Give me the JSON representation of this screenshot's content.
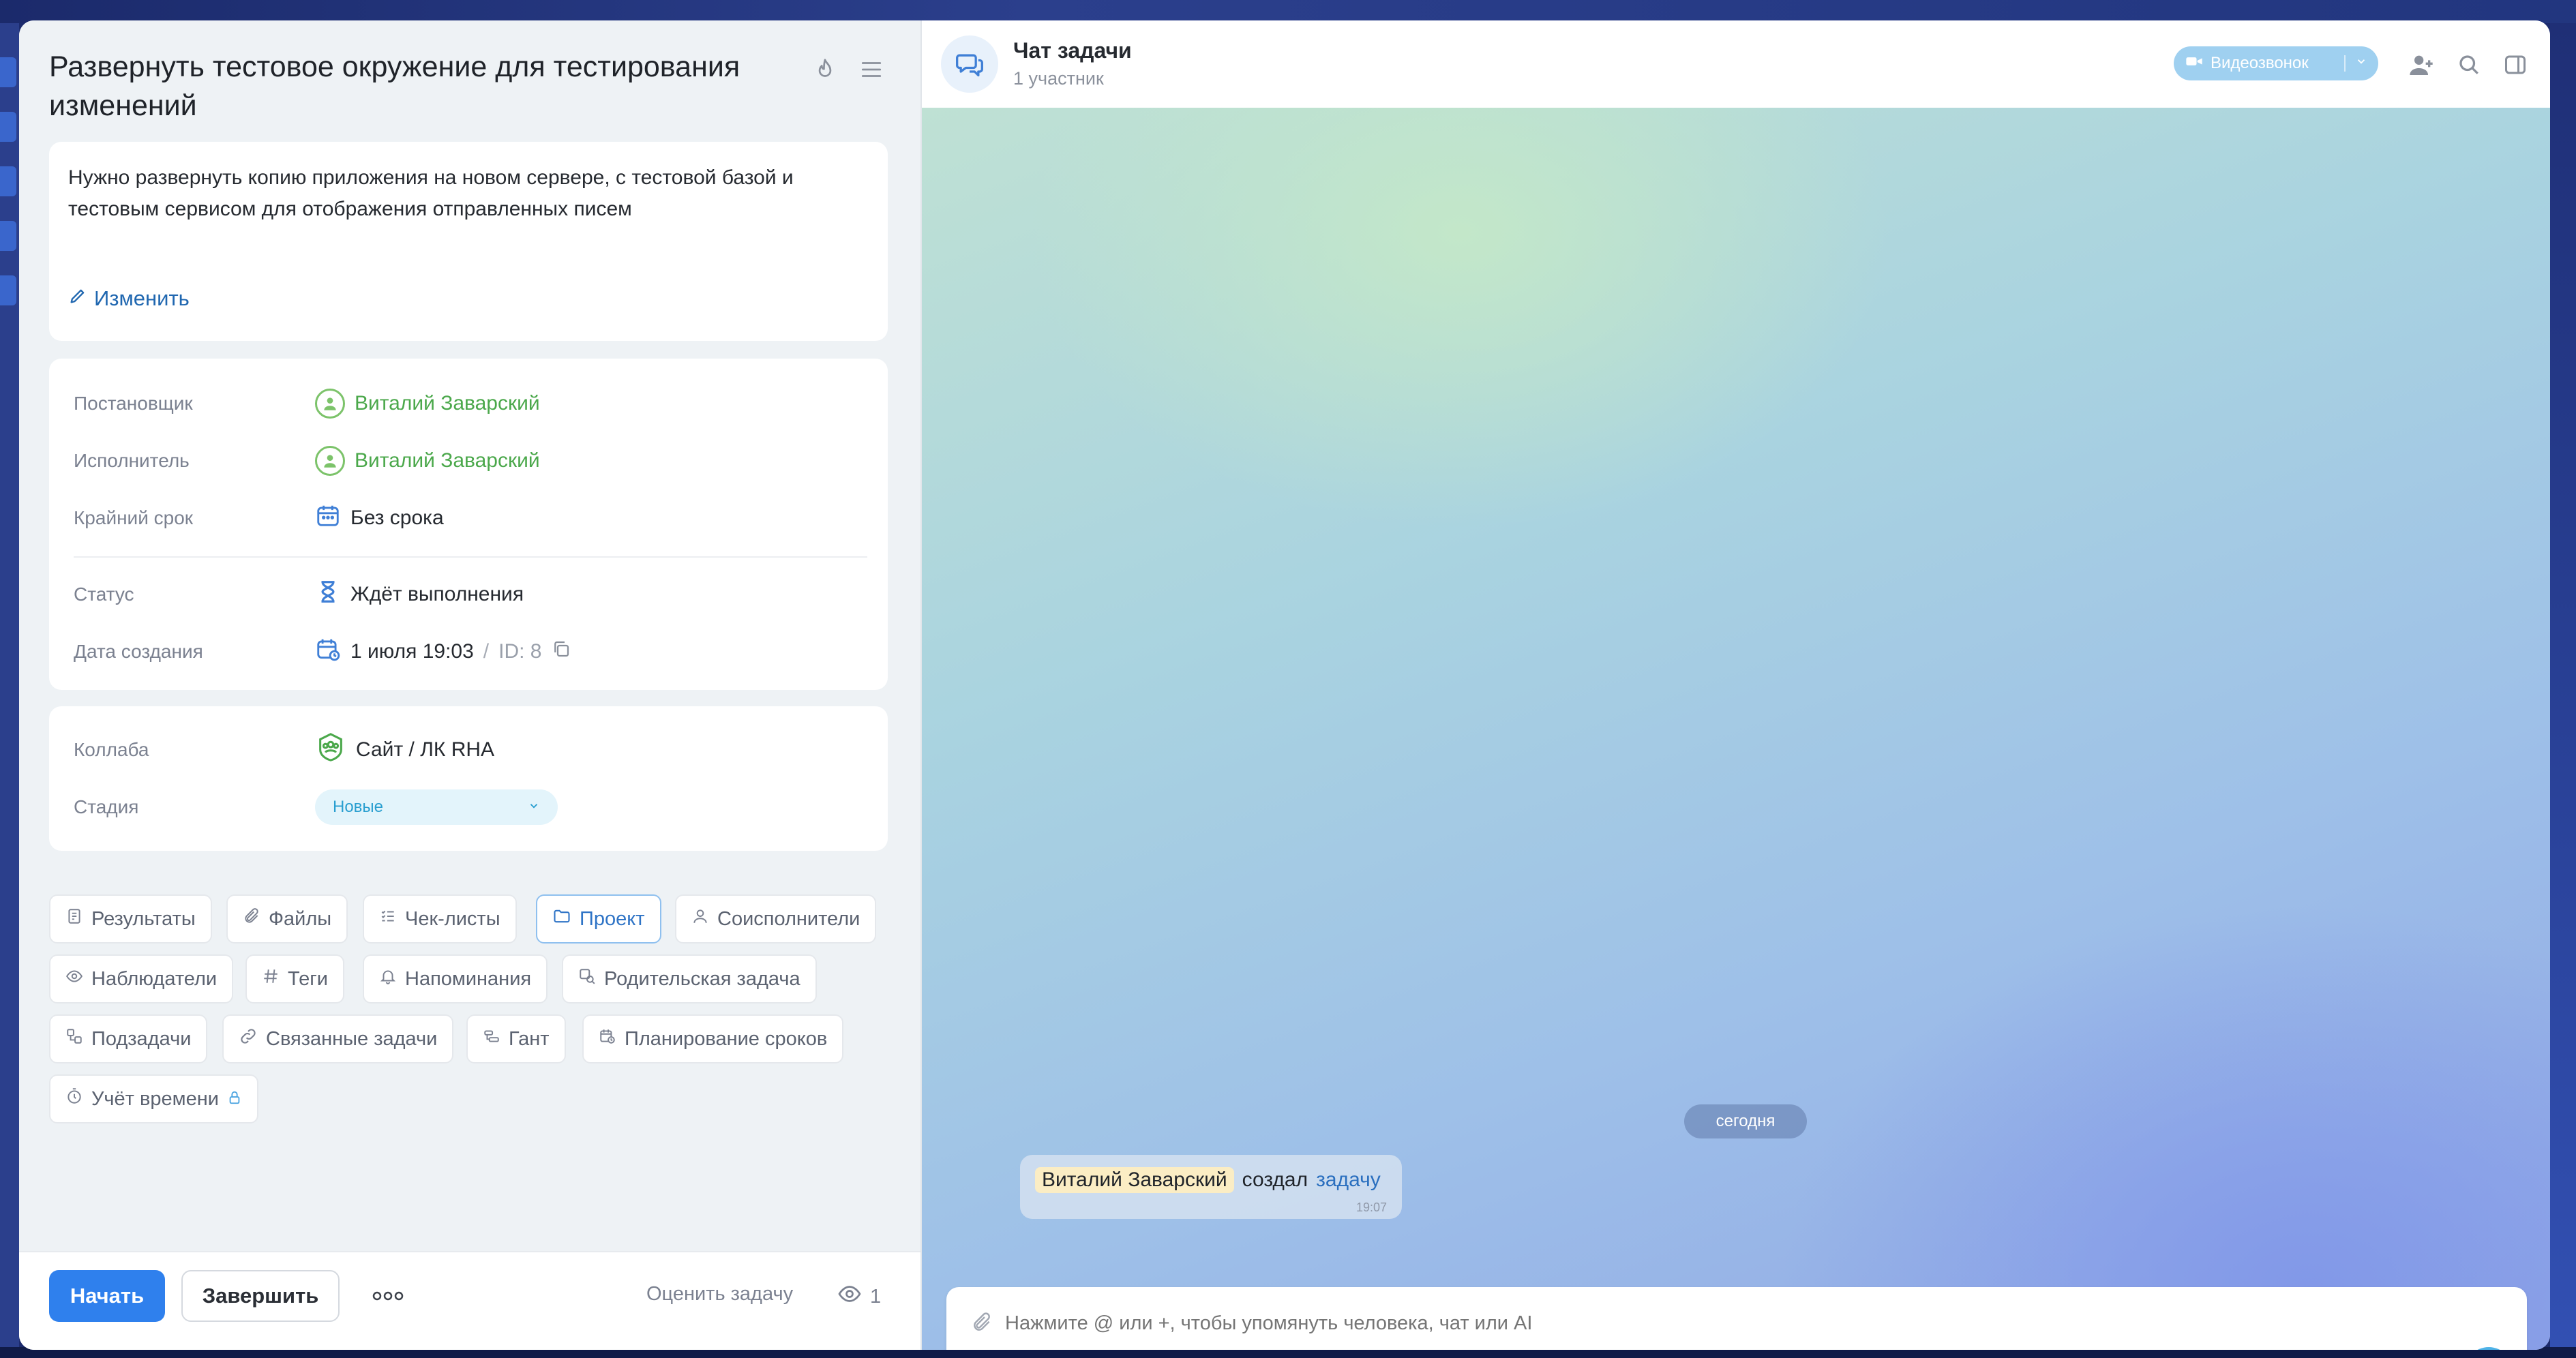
{
  "task": {
    "title": "Развернуть тестовое окружение для тестирования изменений",
    "description": "Нужно развернуть копию приложения на новом сервере, с тестовой базой и тестовым сервисом для отображения отправленных писем",
    "edit_label": "Изменить"
  },
  "details": {
    "creator_label": "Постановщик",
    "creator_value": "Виталий Заварский",
    "assignee_label": "Исполнитель",
    "assignee_value": "Виталий Заварский",
    "deadline_label": "Крайний срок",
    "deadline_value": "Без срока",
    "status_label": "Статус",
    "status_value": "Ждёт выполнения",
    "created_label": "Дата создания",
    "created_value": "1 июля 19:03",
    "separator": "/",
    "id_value": "ID: 8"
  },
  "project": {
    "collab_label": "Коллаба",
    "collab_value": "Сайт / ЛК RHA",
    "stage_label": "Стадия",
    "stage_value": "Новые"
  },
  "chips": {
    "results": "Результаты",
    "files": "Файлы",
    "checklists": "Чек-листы",
    "project": "Проект",
    "coexecutors": "Соисполнители",
    "observers": "Наблюдатели",
    "tags": "Теги",
    "reminders": "Напоминания",
    "parent_task": "Родительская задача",
    "subtasks": "Подзадачи",
    "related_tasks": "Связанные задачи",
    "gantt": "Гант",
    "planning": "Планирование сроков",
    "time_tracking": "Учёт времени"
  },
  "footer": {
    "start_label": "Начать",
    "finish_label": "Завершить",
    "rate_label": "Оценить задачу",
    "views_count": "1"
  },
  "chat": {
    "title": "Чат задачи",
    "subtitle": "1 участник",
    "video_label": "Видеозвонок",
    "date_divider": "сегодня",
    "message": {
      "author": "Виталий Заварский",
      "text": "создал",
      "link": "задачу",
      "time": "19:07"
    },
    "composer_placeholder": "Нажмите @ или +, чтобы упомянуть человека, чат или AI"
  },
  "colors": {
    "accent": "#2f80ed",
    "user_green": "#4ba84b",
    "link_blue": "#2067b0",
    "send_button": "#4fb3e8"
  }
}
